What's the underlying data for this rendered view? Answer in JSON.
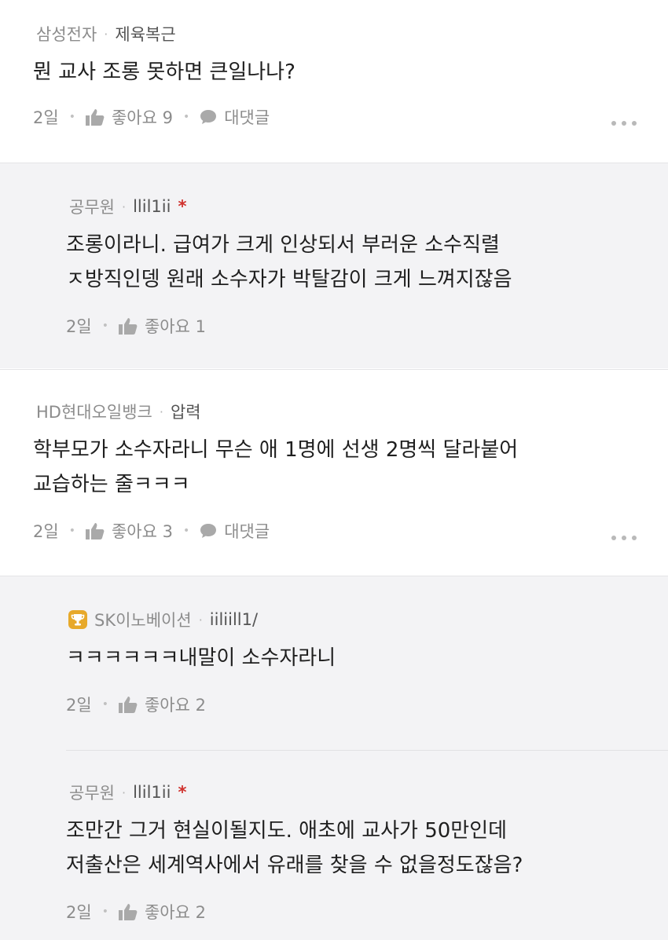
{
  "comments": [
    {
      "company": "삼성전자",
      "nickname": "제육복근",
      "lines": [
        "뭔 교사 조롱 못하면 큰일나나?"
      ],
      "time": "2일",
      "likes": "좋아요 9",
      "reply_label": "대댓글"
    },
    {
      "company": "공무원",
      "nickname": "llil1ii",
      "lines": [
        "조롱이라니. 급여가 크게 인상되서 부러운 소수직렬",
        "ㅈ방직인뎅 원래 소수자가 박탈감이 크게 느껴지잖음"
      ],
      "time": "2일",
      "likes": "좋아요 1"
    },
    {
      "company": "HD현대오일뱅크",
      "nickname": "압력",
      "lines": [
        "학부모가 소수자라니 무슨 애 1명에 선생 2명씩 달라붙어",
        "교습하는 줄ㅋㅋㅋ"
      ],
      "time": "2일",
      "likes": "좋아요 3",
      "reply_label": "대댓글"
    },
    {
      "company": "SK이노베이션",
      "nickname": "iiliill1/",
      "lines": [
        "ㅋㅋㅋㅋㅋㅋ내말이 소수자라니"
      ],
      "time": "2일",
      "likes": "좋아요 2"
    },
    {
      "company": "공무원",
      "nickname": "llil1ii",
      "lines": [
        "조만간 그거 현실이될지도. 애초에 교사가 50만인데",
        "저출산은 세계역사에서 유래를 찾을 수 없을정도잖음?"
      ],
      "time": "2일",
      "likes": "좋아요 2"
    }
  ],
  "colors": {
    "reply_bg": "#f3f3f5",
    "author_mark": "#d0312d",
    "badge_gold": "#e7a92b"
  },
  "icons": [
    "thumbs-up-icon",
    "speech-bubble-icon",
    "more-options-icon",
    "trophy-badge-icon"
  ]
}
